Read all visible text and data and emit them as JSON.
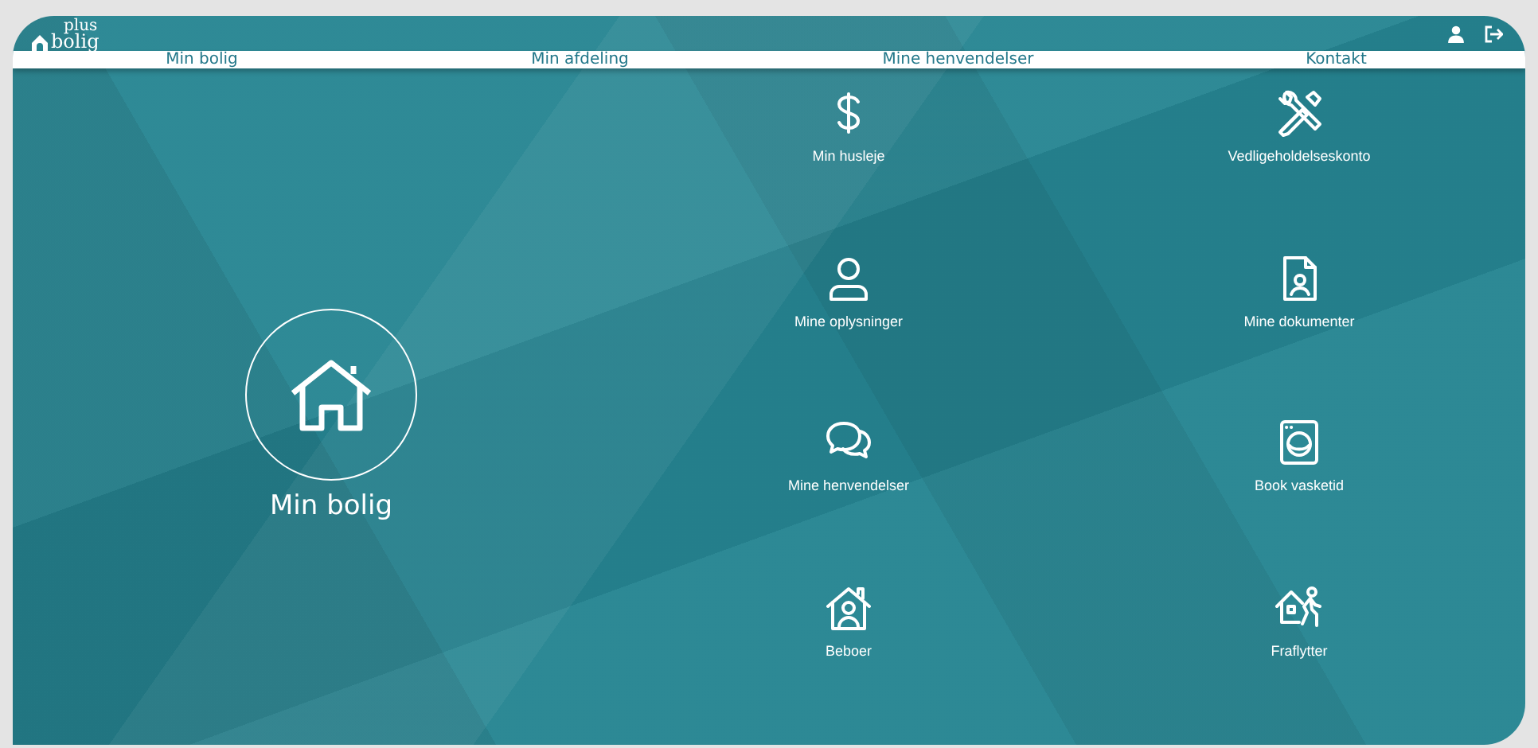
{
  "logo": {
    "word": "bolig",
    "superscript": "plus"
  },
  "nav": [
    {
      "label": "Min bolig"
    },
    {
      "label": "Min afdeling"
    },
    {
      "label": "Mine henvendelser"
    },
    {
      "label": "Kontakt"
    }
  ],
  "hero": {
    "label": "Min bolig"
  },
  "tiles": [
    {
      "kind": "rent",
      "label": "Min husleje"
    },
    {
      "kind": "tools",
      "label": "Vedligeholdelseskonto"
    },
    {
      "kind": "profile",
      "label": "Mine oplysninger"
    },
    {
      "kind": "document",
      "label": "Mine dokumenter"
    },
    {
      "kind": "messages",
      "label": "Mine henvendelser"
    },
    {
      "kind": "laundry",
      "label": "Book vasketid"
    },
    {
      "kind": "resident",
      "label": "Beboer"
    },
    {
      "kind": "moveout",
      "label": "Fraflytter"
    }
  ]
}
